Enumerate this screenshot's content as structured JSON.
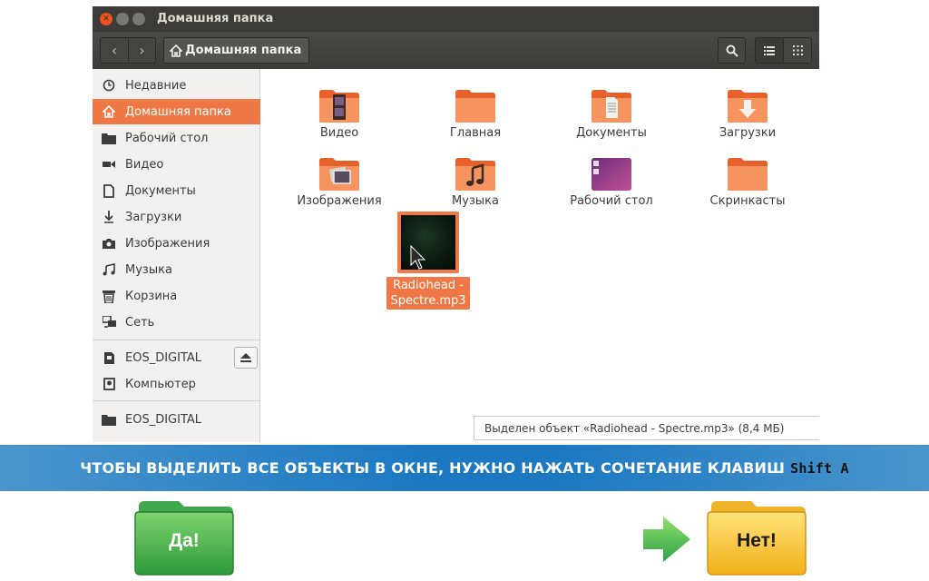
{
  "window": {
    "title": "Домашняя папка"
  },
  "toolbar": {
    "back_icon": "chevron-left-icon",
    "forward_icon": "chevron-right-icon",
    "path_label": "Домашняя папка"
  },
  "sidebar": {
    "items": [
      {
        "label": "Недавние",
        "icon": "clock-icon"
      },
      {
        "label": "Домашняя папка",
        "icon": "home-icon",
        "active": true
      },
      {
        "label": "Рабочий стол",
        "icon": "folder-icon"
      },
      {
        "label": "Видео",
        "icon": "film-icon"
      },
      {
        "label": "Документы",
        "icon": "document-icon"
      },
      {
        "label": "Загрузки",
        "icon": "download-icon"
      },
      {
        "label": "Изображения",
        "icon": "camera-icon"
      },
      {
        "label": "Музыка",
        "icon": "music-icon"
      },
      {
        "label": "Корзина",
        "icon": "trash-icon"
      },
      {
        "label": "Сеть",
        "icon": "network-icon"
      }
    ],
    "devices": [
      {
        "label": "EOS_DIGITAL",
        "icon": "sd-card-icon"
      },
      {
        "label": "Компьютер",
        "icon": "drive-icon"
      }
    ],
    "other": [
      {
        "label": "EOS_DIGITAL",
        "icon": "folder-icon"
      }
    ]
  },
  "files": [
    {
      "label": "Видео",
      "emblem": "film"
    },
    {
      "label": "Главная",
      "emblem": "none"
    },
    {
      "label": "Документы",
      "emblem": "document"
    },
    {
      "label": "Загрузки",
      "emblem": "download"
    },
    {
      "label": "Изображения",
      "emblem": "pictures"
    },
    {
      "label": "Музыка",
      "emblem": "music"
    },
    {
      "label": "Рабочий стол",
      "emblem": "desktop"
    },
    {
      "label": "Скринкасты",
      "emblem": "none"
    }
  ],
  "selected_file": {
    "label_line1": "Radiohead -",
    "label_line2": "Spectre.mp3"
  },
  "statusbar": {
    "text": "Выделен объект «Radiohead - Spectre.mp3» (8,4 МБ)"
  },
  "quiz": {
    "question": "ЧТОБЫ ВЫДЕЛИТЬ ВСЕ ОБЪЕКТЫ В ОКНЕ, НУЖНО НАЖАТЬ СОЧЕТАНИЕ КЛАВИШ",
    "keys": "Shift A",
    "answer_yes": "Да!",
    "answer_no": "Нет!"
  },
  "colors": {
    "accent": "#f07746",
    "titlebar": "#3c3b37",
    "banner": "#1c79c1",
    "yes_folder": "#4caf50",
    "no_folder": "#f5c518"
  }
}
